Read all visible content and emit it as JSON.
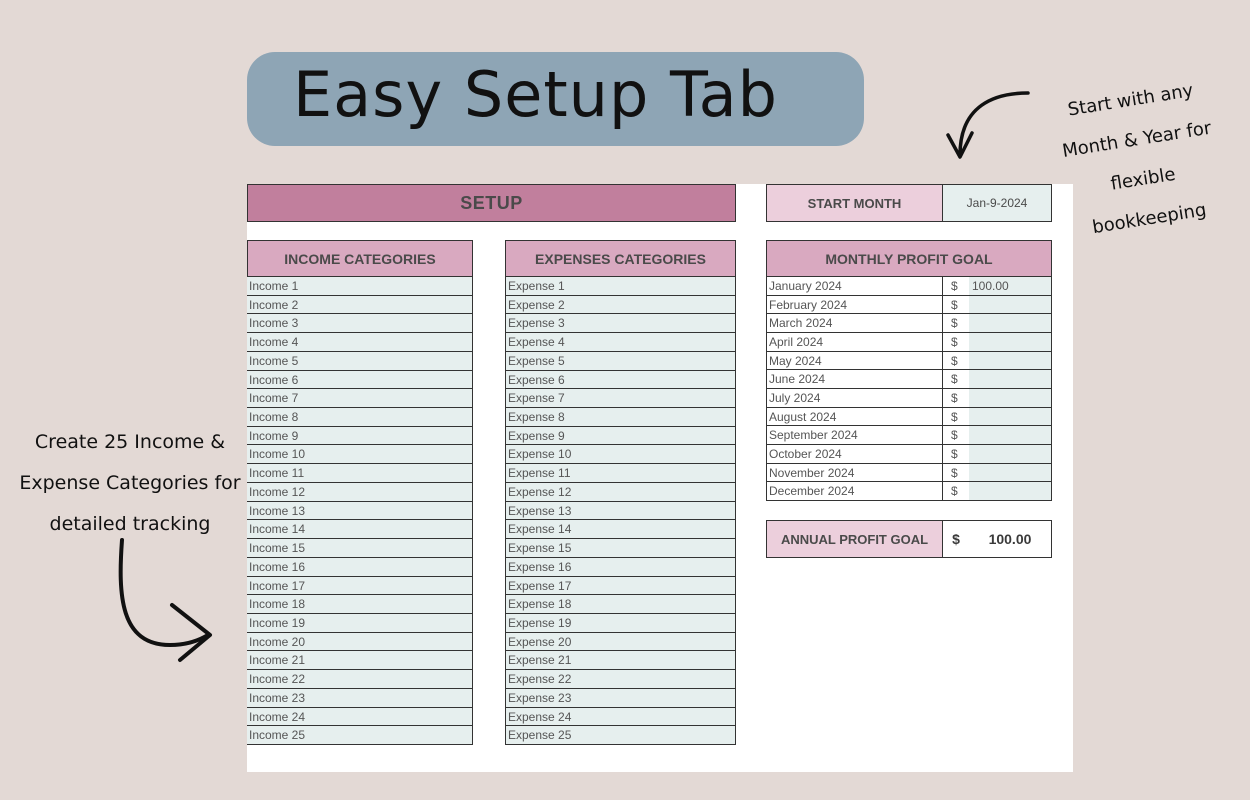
{
  "banner": {
    "title": "Easy Setup Tab"
  },
  "annotations": {
    "right_lines": [
      "Start with any",
      "Month & Year for",
      "flexible",
      "bookkeeping"
    ],
    "left_lines": [
      "Create 25 Income &",
      "Expense Categories for",
      "detailed tracking"
    ]
  },
  "sheet": {
    "setup_header": "SETUP",
    "start_month_label": "START MONTH",
    "start_month_value": "Jan-9-2024",
    "income_header": "INCOME CATEGORIES",
    "expense_header": "EXPENSES CATEGORIES",
    "profit_header": "MONTHLY PROFIT GOAL",
    "income": [
      "Income 1",
      "Income 2",
      "Income 3",
      "Income 4",
      "Income 5",
      "Income 6",
      "Income 7",
      "Income 8",
      "Income 9",
      "Income 10",
      "Income 11",
      "Income 12",
      "Income 13",
      "Income 14",
      "Income 15",
      "Income 16",
      "Income 17",
      "Income 18",
      "Income 19",
      "Income 20",
      "Income 21",
      "Income 22",
      "Income 23",
      "Income 24",
      "Income 25"
    ],
    "expenses": [
      "Expense 1",
      "Expense 2",
      "Expense 3",
      "Expense 4",
      "Expense 5",
      "Expense 6",
      "Expense 7",
      "Expense 8",
      "Expense 9",
      "Expense 10",
      "Expense 11",
      "Expense 12",
      "Expense 13",
      "Expense 14",
      "Expense 15",
      "Expense 16",
      "Expense 17",
      "Expense 18",
      "Expense 19",
      "Expense 20",
      "Expense 21",
      "Expense 22",
      "Expense 23",
      "Expense 24",
      "Expense 25"
    ],
    "months": [
      {
        "name": "January 2024",
        "currency": "$",
        "value": "100.00"
      },
      {
        "name": "February 2024",
        "currency": "$",
        "value": ""
      },
      {
        "name": "March 2024",
        "currency": "$",
        "value": ""
      },
      {
        "name": "April 2024",
        "currency": "$",
        "value": ""
      },
      {
        "name": "May 2024",
        "currency": "$",
        "value": ""
      },
      {
        "name": "June 2024",
        "currency": "$",
        "value": ""
      },
      {
        "name": "July 2024",
        "currency": "$",
        "value": ""
      },
      {
        "name": "August 2024",
        "currency": "$",
        "value": ""
      },
      {
        "name": "September 2024",
        "currency": "$",
        "value": ""
      },
      {
        "name": "October 2024",
        "currency": "$",
        "value": ""
      },
      {
        "name": "November 2024",
        "currency": "$",
        "value": ""
      },
      {
        "name": "December 2024",
        "currency": "$",
        "value": ""
      }
    ],
    "annual_label": "ANNUAL PROFIT GOAL",
    "annual_currency": "$",
    "annual_value": "100.00"
  }
}
